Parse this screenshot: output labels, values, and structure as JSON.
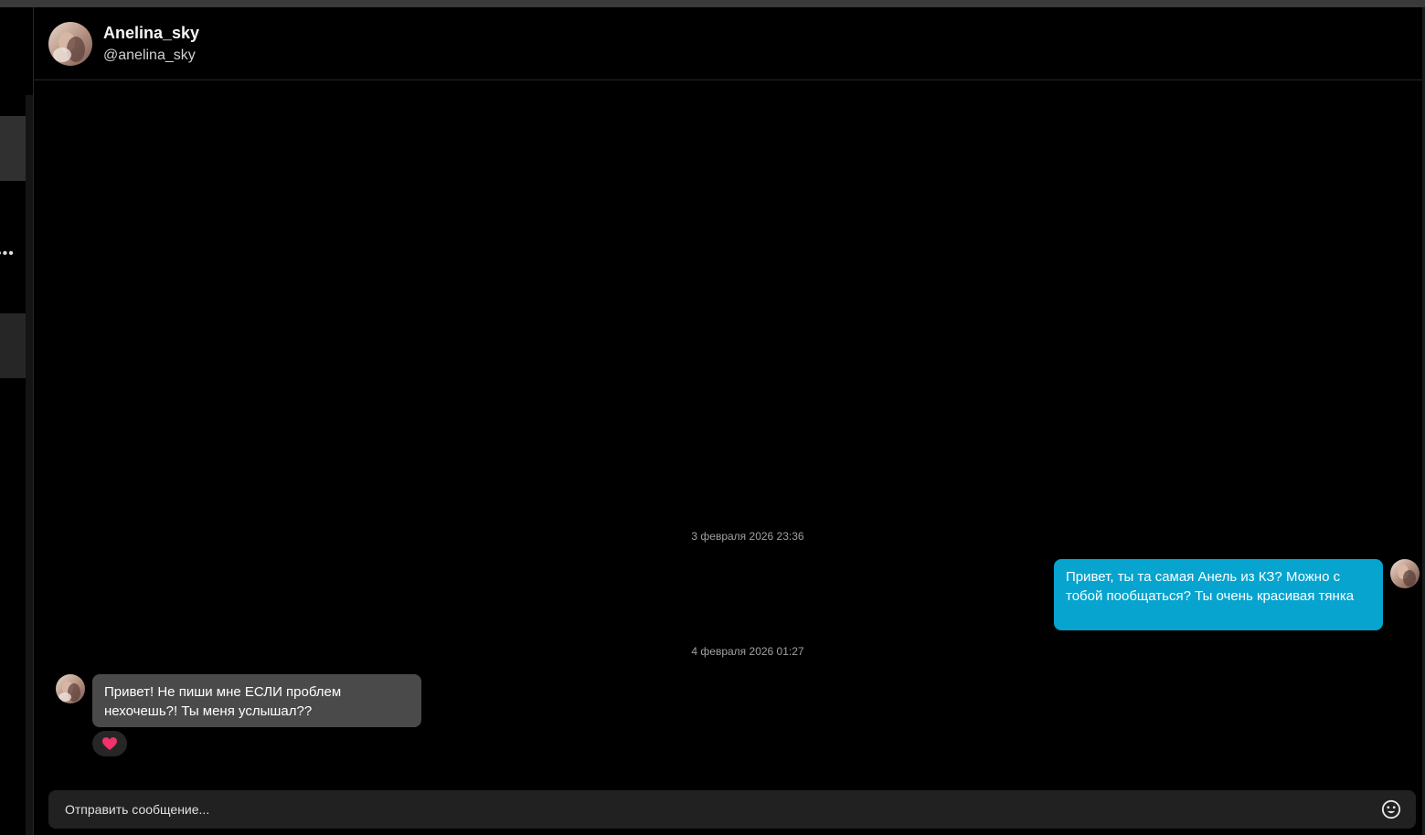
{
  "contact": {
    "display_name": "Anelina_sky",
    "handle": "@anelina_sky"
  },
  "sidebar": {
    "more_glyph": "•••"
  },
  "messages": [
    {
      "timestamp": "3 февраля 2026 23:36",
      "direction": "outgoing",
      "text": "Привет, ты та самая Анель из КЗ? Можно с тобой пообщаться? Ты очень красивая тянка"
    },
    {
      "timestamp": "4 февраля 2026 01:27",
      "direction": "incoming",
      "text": "Привет! Не пиши мне ЕСЛИ проблем нехочешь?! Ты меня услышал??",
      "reaction": "heart-icon"
    }
  ],
  "composer": {
    "placeholder": "Отправить сообщение..."
  },
  "colors": {
    "outgoing_bubble": "#06a4cf",
    "incoming_bubble": "#4a4a4a",
    "reaction_heart": "#f0336b",
    "background": "#000000"
  }
}
